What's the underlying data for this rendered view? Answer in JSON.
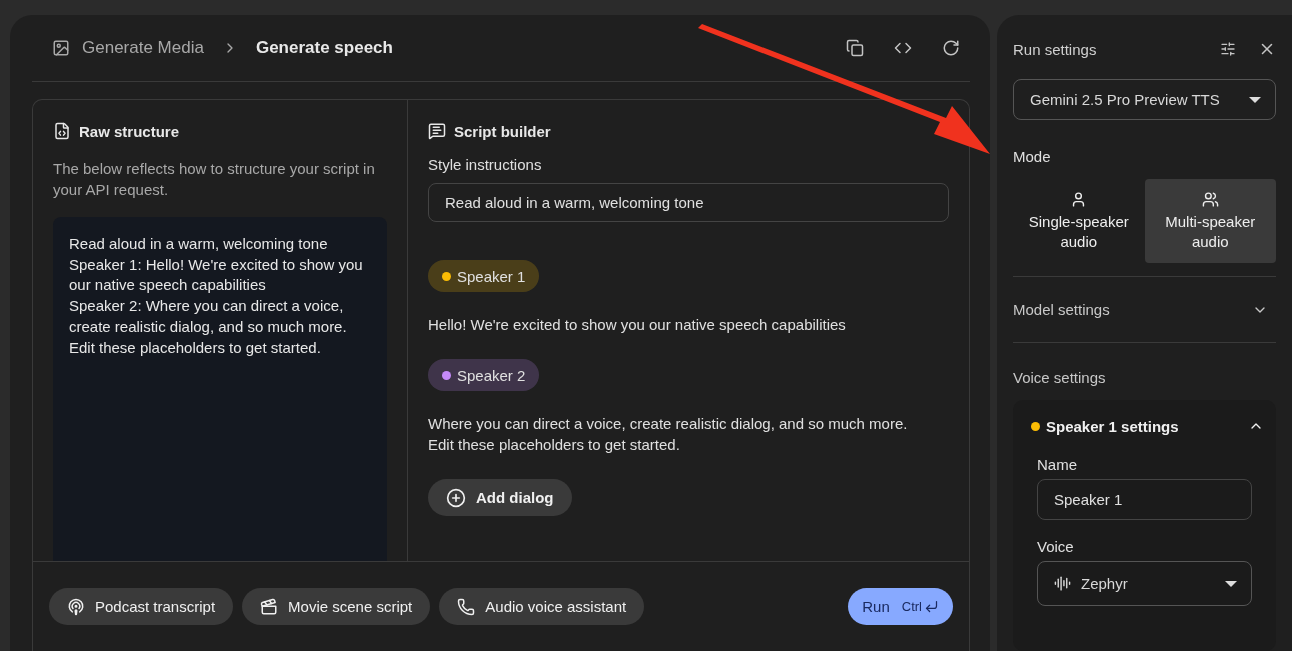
{
  "breadcrumb": {
    "parent": "Generate Media",
    "current": "Generate speech"
  },
  "raw_structure": {
    "title": "Raw structure",
    "description": "The below reflects how to structure your script in your API request.",
    "lines": [
      "Read aloud in a warm, welcoming tone",
      "Speaker 1: Hello! We're excited to show you our native speech capabilities",
      "Speaker 2: Where you can direct a voice, create realistic dialog, and so much more. Edit these placeholders to get started."
    ]
  },
  "script_builder": {
    "title": "Script builder",
    "style_label": "Style instructions",
    "style_value": "Read aloud in a warm, welcoming tone",
    "dialogs": [
      {
        "speaker": "Speaker 1",
        "color": "#fbbc04",
        "text": "Hello! We're excited to show you our native speech capabilities"
      },
      {
        "speaker": "Speaker 2",
        "color": "#c58af9",
        "text": "Where you can direct a voice, create realistic dialog, and so much more. Edit these placeholders to get started."
      }
    ],
    "add_button": "Add dialog"
  },
  "presets": [
    {
      "kind": "podcast",
      "label": "Podcast transcript"
    },
    {
      "kind": "movie",
      "label": "Movie scene script"
    },
    {
      "kind": "phone",
      "label": "Audio voice assistant"
    }
  ],
  "run_button": {
    "label": "Run",
    "shortcut": "Ctrl"
  },
  "run_settings": {
    "title": "Run settings",
    "model": "Gemini 2.5 Pro Preview TTS",
    "mode_label": "Mode",
    "modes": [
      {
        "kind": "single",
        "label": "Single-speaker audio",
        "selected": false
      },
      {
        "kind": "multi",
        "label": "Multi-speaker audio",
        "selected": true
      }
    ],
    "model_settings": {
      "label": "Model settings",
      "expanded": false
    },
    "voice_settings": {
      "label": "Voice settings",
      "speaker": {
        "title": "Speaker 1 settings",
        "color": "#fbbc04",
        "expanded": true,
        "name_label": "Name",
        "name_value": "Speaker 1",
        "voice_label": "Voice",
        "voice_value": "Zephyr"
      }
    }
  }
}
